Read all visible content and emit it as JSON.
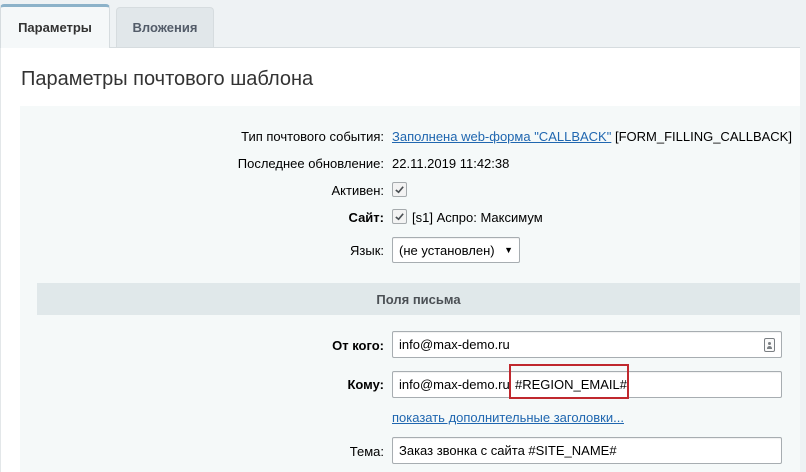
{
  "tabs": [
    {
      "label": "Параметры",
      "active": true
    },
    {
      "label": "Вложения",
      "active": false
    }
  ],
  "page": {
    "title": "Параметры почтового шаблона"
  },
  "params": {
    "event_type_label": "Тип почтового события:",
    "event_type_link": "Заполнена web-форма \"CALLBACK\"",
    "event_type_code": "[FORM_FILLING_CALLBACK]",
    "last_update_label": "Последнее обновление:",
    "last_update_value": "22.11.2019 11:42:38",
    "active_label": "Активен:",
    "active_checked": true,
    "site_label": "Сайт:",
    "site_checked": true,
    "site_value": "[s1] Аспро: Максимум",
    "lang_label": "Язык:",
    "lang_value": "(не установлен)"
  },
  "letter": {
    "section_title": "Поля письма",
    "from_label": "От кого:",
    "from_value": "info@max-demo.ru",
    "to_label": "Кому:",
    "to_value": "info@max-demo.ru",
    "to_highlight": "#REGION_EMAIL#",
    "show_headers_link": "показать дополнительные заголовки...",
    "subject_label": "Тема:",
    "subject_value": "Заказ звонка с сайта #SITE_NAME#"
  },
  "icons": {
    "checkbox": "check-icon",
    "select_arrow": "chevron-down-icon",
    "address_book": "address-book-icon"
  },
  "colors": {
    "link": "#2067b0",
    "highlight_border": "#c0282e",
    "section_bg": "#e0e8ea",
    "form_bg": "#f5f9f9"
  }
}
